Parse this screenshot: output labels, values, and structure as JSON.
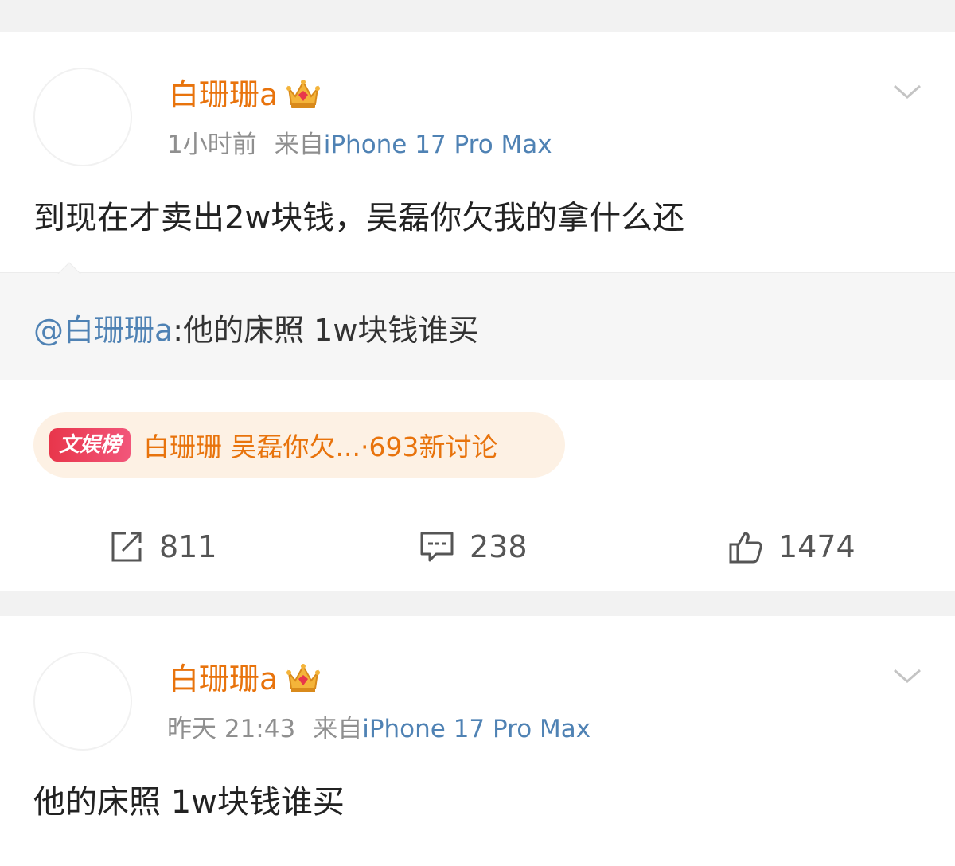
{
  "posts": [
    {
      "username": "白珊珊a",
      "time": "1小时前",
      "source_prefix": "来自",
      "device": "iPhone 17 Pro Max",
      "text": "到现在才卖出2w块钱，吴磊你欠我的拿什么还",
      "repost": {
        "mention": "@白珊珊a",
        "text": ":他的床照 1w块钱谁买"
      },
      "topic": {
        "badge": "文娱榜",
        "title": "白珊珊 吴磊你欠...",
        "count": "·693新讨论"
      },
      "actions": {
        "repost_count": "811",
        "comment_count": "238",
        "like_count": "1474"
      }
    },
    {
      "username": "白珊珊a",
      "time": "昨天 21:43",
      "source_prefix": "来自",
      "device": "iPhone 17 Pro Max",
      "text": "他的床照 1w块钱谁买"
    }
  ],
  "colors": {
    "username": "#e8730c",
    "device_link": "#4f82b4",
    "mention": "#4f82b4",
    "meta": "#8f8f8f",
    "topic_bg": "#fdf1e4",
    "topic_badge": "#e8364b"
  },
  "icons": {
    "vip": "crown-icon",
    "menu": "chevron-down-icon",
    "repost": "repost-icon",
    "comment": "comment-icon",
    "like": "thumbs-up-icon"
  }
}
